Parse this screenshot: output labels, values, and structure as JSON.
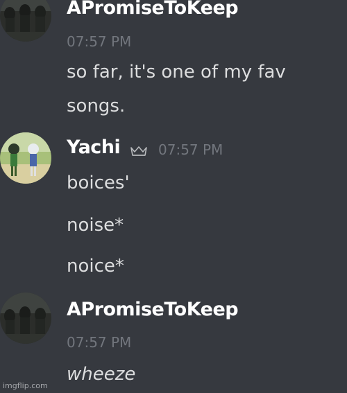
{
  "messages": [
    {
      "username": "APromiseToKeep",
      "avatar_icon": "dark-forest-soldiers-avatar",
      "timestamp": "07:57 PM",
      "lines": [
        "so far, it's one of my fav",
        "songs."
      ]
    },
    {
      "username": "Yachi",
      "avatar_icon": "anime-characters-avatar",
      "badge_icon": "crown-icon",
      "timestamp": "07:57 PM",
      "lines": [
        "boices'",
        "noise*",
        "noice*"
      ]
    },
    {
      "username": "APromiseToKeep",
      "avatar_icon": "dark-forest-soldiers-avatar",
      "timestamp": "07:57 PM",
      "lines": [
        "wheeze"
      ]
    }
  ],
  "watermark": "imgflip.com",
  "colors": {
    "background": "#36393f",
    "username": "#ffffff",
    "message_text": "#dcddde",
    "timestamp": "#72767d"
  }
}
